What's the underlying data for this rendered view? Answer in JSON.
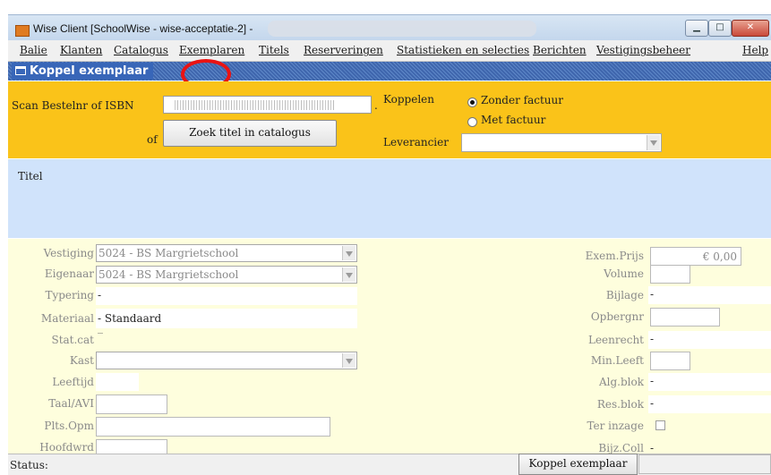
{
  "window": {
    "title": "Wise Client [SchoolWise - wise-acceptatie-2] -"
  },
  "window_controls": {
    "minimize": "▁",
    "maximize": "□",
    "close": "✕"
  },
  "menu": [
    "Balie",
    "Klanten",
    "Catalogus",
    "Exemplaren",
    "Titels",
    "Reserveringen",
    "Statistieken en selecties",
    "Berichten",
    "Vestigingsbeheer",
    "Help"
  ],
  "panel": {
    "title": "Koppel exemplaar"
  },
  "scan": {
    "label": "Scan Bestelnr of ISBN",
    "dot": ".",
    "of_label": "of",
    "search_button": "Zoek titel in catalogus",
    "koppelen_label": "Koppelen",
    "radio_zonder": "Zonder factuur",
    "radio_met": "Met factuur",
    "selected": "Zonder factuur",
    "leverancier_label": "Leverancier",
    "leverancier_value": ""
  },
  "titel_label": "Titel",
  "form": {
    "vestiging": {
      "label": "Vestiging",
      "value": "5024 - BS Margrietschool"
    },
    "eigenaar": {
      "label": "Eigenaar",
      "value": "5024 - BS Margrietschool"
    },
    "typering": {
      "label": "Typering",
      "value": "-"
    },
    "materiaal": {
      "label": "Materiaal",
      "value": "- Standaard"
    },
    "statcat": {
      "label": "Stat.cat",
      "value": "_"
    },
    "kast": {
      "label": "Kast",
      "value": ""
    },
    "leeftijd": {
      "label": "Leeftijd",
      "value": ""
    },
    "taal_avi": {
      "label": "Taal/AVI",
      "value": ""
    },
    "plts_opm": {
      "label": "Plts.Opm",
      "value": ""
    },
    "hoofdwoord": {
      "label": "Hoofdwrd",
      "value": ""
    },
    "exem_prijs": {
      "label": "Exem.Prijs",
      "value": "€ 0,00"
    },
    "volume": {
      "label": "Volume",
      "value": ""
    },
    "bijlage": {
      "label": "Bijlage",
      "value": "-"
    },
    "opbergnr": {
      "label": "Opbergnr",
      "value": ""
    },
    "leenrecht": {
      "label": "Leenrecht",
      "value": "-"
    },
    "min_leeft": {
      "label": "Min.Leeft",
      "value": ""
    },
    "alg_blok": {
      "label": "Alg.blok",
      "value": "-"
    },
    "res_blok": {
      "label": "Res.blok",
      "value": "-"
    },
    "ter_inzage": {
      "label": "Ter inzage",
      "checked": false
    },
    "bijz_coll": {
      "label": "Bijz.Coll",
      "value": "-"
    }
  },
  "status": {
    "label": "Status:",
    "button": "Koppel exemplaar",
    "value": ""
  },
  "colors": {
    "yellow": "#fac319",
    "blue_header": "#3866b8",
    "title_area": "#d0e3fb",
    "form_area": "#fefedd",
    "annotation_red": "#ea1313"
  }
}
